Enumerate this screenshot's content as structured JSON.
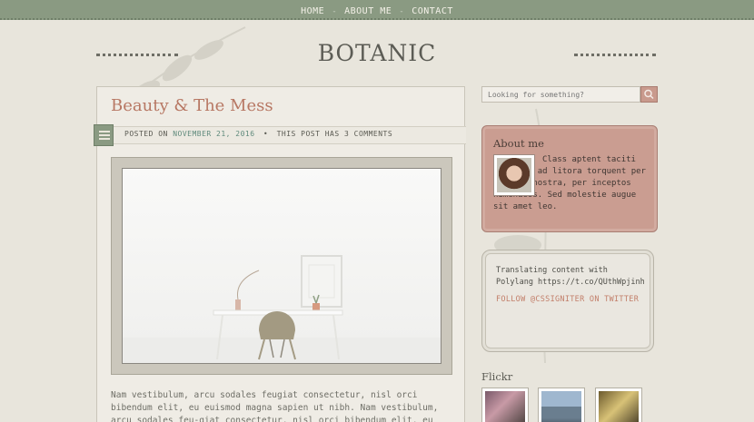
{
  "nav": {
    "items": [
      "HOME",
      "ABOUT ME",
      "CONTACT"
    ],
    "separator": "-"
  },
  "site": {
    "title": "BOTANIC"
  },
  "post": {
    "title": "Beauty & The Mess",
    "meta_prefix": "POSTED ON",
    "date": "NOVEMBER 21, 2016",
    "bullet": "•",
    "comments": "THIS POST HAS 3 COMMENTS",
    "body": "Nam vestibulum, arcu sodales feugiat consectetur, nisl orci bibendum elit, eu euismod magna sapien ut nibh. Nam vestibulum, arcu sodales feu-giat consectetur, nisl orci bibendum elit, eu euismod magna sapien ut"
  },
  "sidebar": {
    "search_placeholder": "Looking for something?",
    "about": {
      "title": "About me",
      "text": "Class aptent taciti sociosqu ad litora torquent per conubia nostra, per inceptos himenaeos. Sed molestie augue sit amet leo."
    },
    "twitter": {
      "tweet": "Translating content with Polylang https://t.co/QUthWpjinh",
      "follow": "FOLLOW @CSSIGNITER ON TWITTER"
    },
    "flickr": {
      "title": "Flickr"
    }
  },
  "colors": {
    "nav_bg": "#8a9a82",
    "accent_title": "#b77763",
    "about_bg": "#ca9d91",
    "date_link": "#5f8a7c"
  },
  "icons": [
    "calendar-icon",
    "search-icon"
  ]
}
